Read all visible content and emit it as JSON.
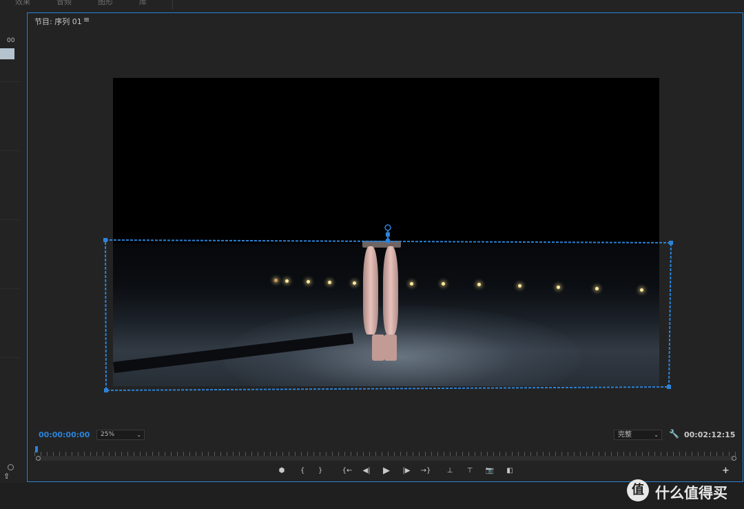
{
  "top_tabs": [
    "效果",
    "音频",
    "图形",
    "库"
  ],
  "left_panel": {
    "timecode_fragment": "00"
  },
  "program_monitor": {
    "title": "节目: 序列 01",
    "menu_icon": "hamburger-icon",
    "timecode_current": "00:00:00:00",
    "zoom_value": "25%",
    "quality_value": "完整",
    "timecode_duration": "00:02:12:15",
    "accent_color": "#2c83d8"
  },
  "transport_buttons": [
    {
      "name": "add-marker-button",
      "glyph": "⬢"
    },
    {
      "name": "mark-in-button",
      "glyph": "{"
    },
    {
      "name": "mark-out-button",
      "glyph": "}"
    },
    {
      "name": "go-to-in-button",
      "glyph": "{←"
    },
    {
      "name": "step-back-button",
      "glyph": "◀|"
    },
    {
      "name": "play-button",
      "glyph": "▶"
    },
    {
      "name": "step-forward-button",
      "glyph": "|▶"
    },
    {
      "name": "go-to-out-button",
      "glyph": "→}"
    },
    {
      "name": "lift-button",
      "glyph": "⊥"
    },
    {
      "name": "extract-button",
      "glyph": "⊤"
    },
    {
      "name": "export-frame-button",
      "glyph": "📷"
    },
    {
      "name": "comparison-view-button",
      "glyph": "◧"
    }
  ],
  "add_button_label": "+",
  "watermark": {
    "logo_glyph": "值",
    "text": "什么值得买"
  }
}
